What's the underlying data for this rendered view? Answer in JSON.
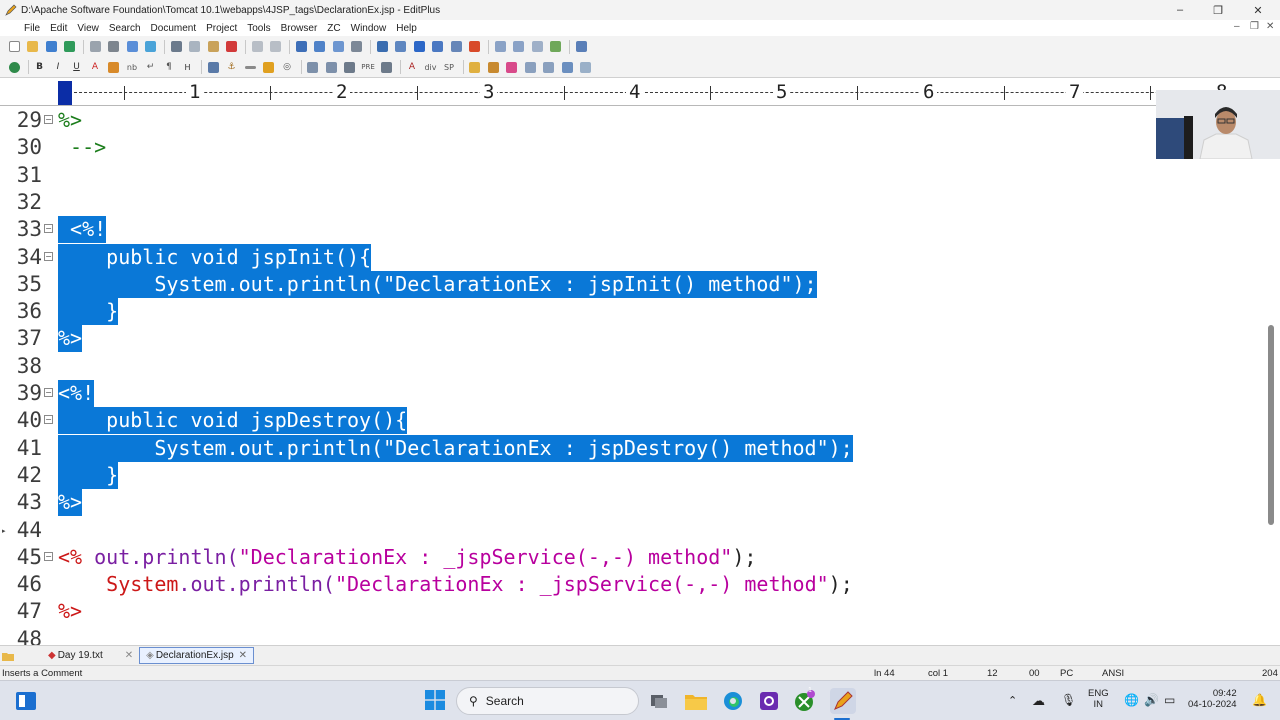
{
  "window": {
    "title": "D:\\Apache Software Foundation\\Tomcat 10.1\\webapps\\4JSP_tags\\DeclarationEx.jsp - EditPlus",
    "controls": {
      "minimize": "–",
      "restore": "❐",
      "close": "✕"
    }
  },
  "menu": [
    "File",
    "Edit",
    "View",
    "Search",
    "Document",
    "Project",
    "Tools",
    "Browser",
    "ZC",
    "Window",
    "Help"
  ],
  "ruler": {
    "numbers": [
      "1",
      "2",
      "3",
      "4",
      "5",
      "6",
      "7",
      "8"
    ]
  },
  "editor": {
    "lines": [
      {
        "n": "29",
        "fold": true
      },
      {
        "n": "30",
        "fold": false
      },
      {
        "n": "31",
        "fold": false
      },
      {
        "n": "32",
        "fold": false
      },
      {
        "n": "33",
        "fold": true
      },
      {
        "n": "34",
        "fold": true
      },
      {
        "n": "35",
        "fold": false
      },
      {
        "n": "36",
        "fold": false
      },
      {
        "n": "37",
        "fold": false
      },
      {
        "n": "38",
        "fold": false
      },
      {
        "n": "39",
        "fold": true
      },
      {
        "n": "40",
        "fold": true
      },
      {
        "n": "41",
        "fold": false
      },
      {
        "n": "42",
        "fold": false
      },
      {
        "n": "43",
        "fold": false
      },
      {
        "n": "44",
        "fold": false
      },
      {
        "n": "45",
        "fold": true
      },
      {
        "n": "46",
        "fold": false
      },
      {
        "n": "47",
        "fold": false
      },
      {
        "n": "48",
        "fold": false
      }
    ],
    "code": {
      "l29": "%>",
      "l30": " -->",
      "l33": " <%!",
      "l34": "    public void jspInit(){",
      "l35": "        System.out.println(\"DeclarationEx : jspInit() method\");",
      "l36": "    }",
      "l37": "%>",
      "l39": "<%!",
      "l40": "    public void jspDestroy(){",
      "l41": "        System.out.println(\"DeclarationEx : jspDestroy() method\");",
      "l42": "    }",
      "l43": "%>",
      "l45_open": "<%",
      "l45_obj": " out.println(",
      "l45_str": "\"DeclarationEx : _jspService(-,-) method\"",
      "l45_end": ");",
      "l46_indent": "    ",
      "l46_obj": "System",
      "l46_mid": ".out.println(",
      "l46_str": "\"DeclarationEx : _jspService(-,-) method\"",
      "l46_end": ");",
      "l47": "%>"
    },
    "colors": {
      "selection": "#0a78d7",
      "tag": "#1b7d1b",
      "string": "#b8009e",
      "object": "#cc1818"
    }
  },
  "tabs": [
    {
      "label": "Day 19.txt",
      "active": false
    },
    {
      "label": "DeclarationEx.jsp",
      "active": true
    }
  ],
  "status": {
    "hint": "Inserts a Comment",
    "line": "ln 44",
    "col": "col 1",
    "total": "12",
    "code": "00",
    "os": "PC",
    "encoding": "ANSI",
    "right": "204"
  },
  "taskbar": {
    "search_label": "Search",
    "notification_badge": "1",
    "lang_top": "ENG",
    "lang_bottom": "IN",
    "time": "09:42",
    "date": "04-10-2024"
  }
}
